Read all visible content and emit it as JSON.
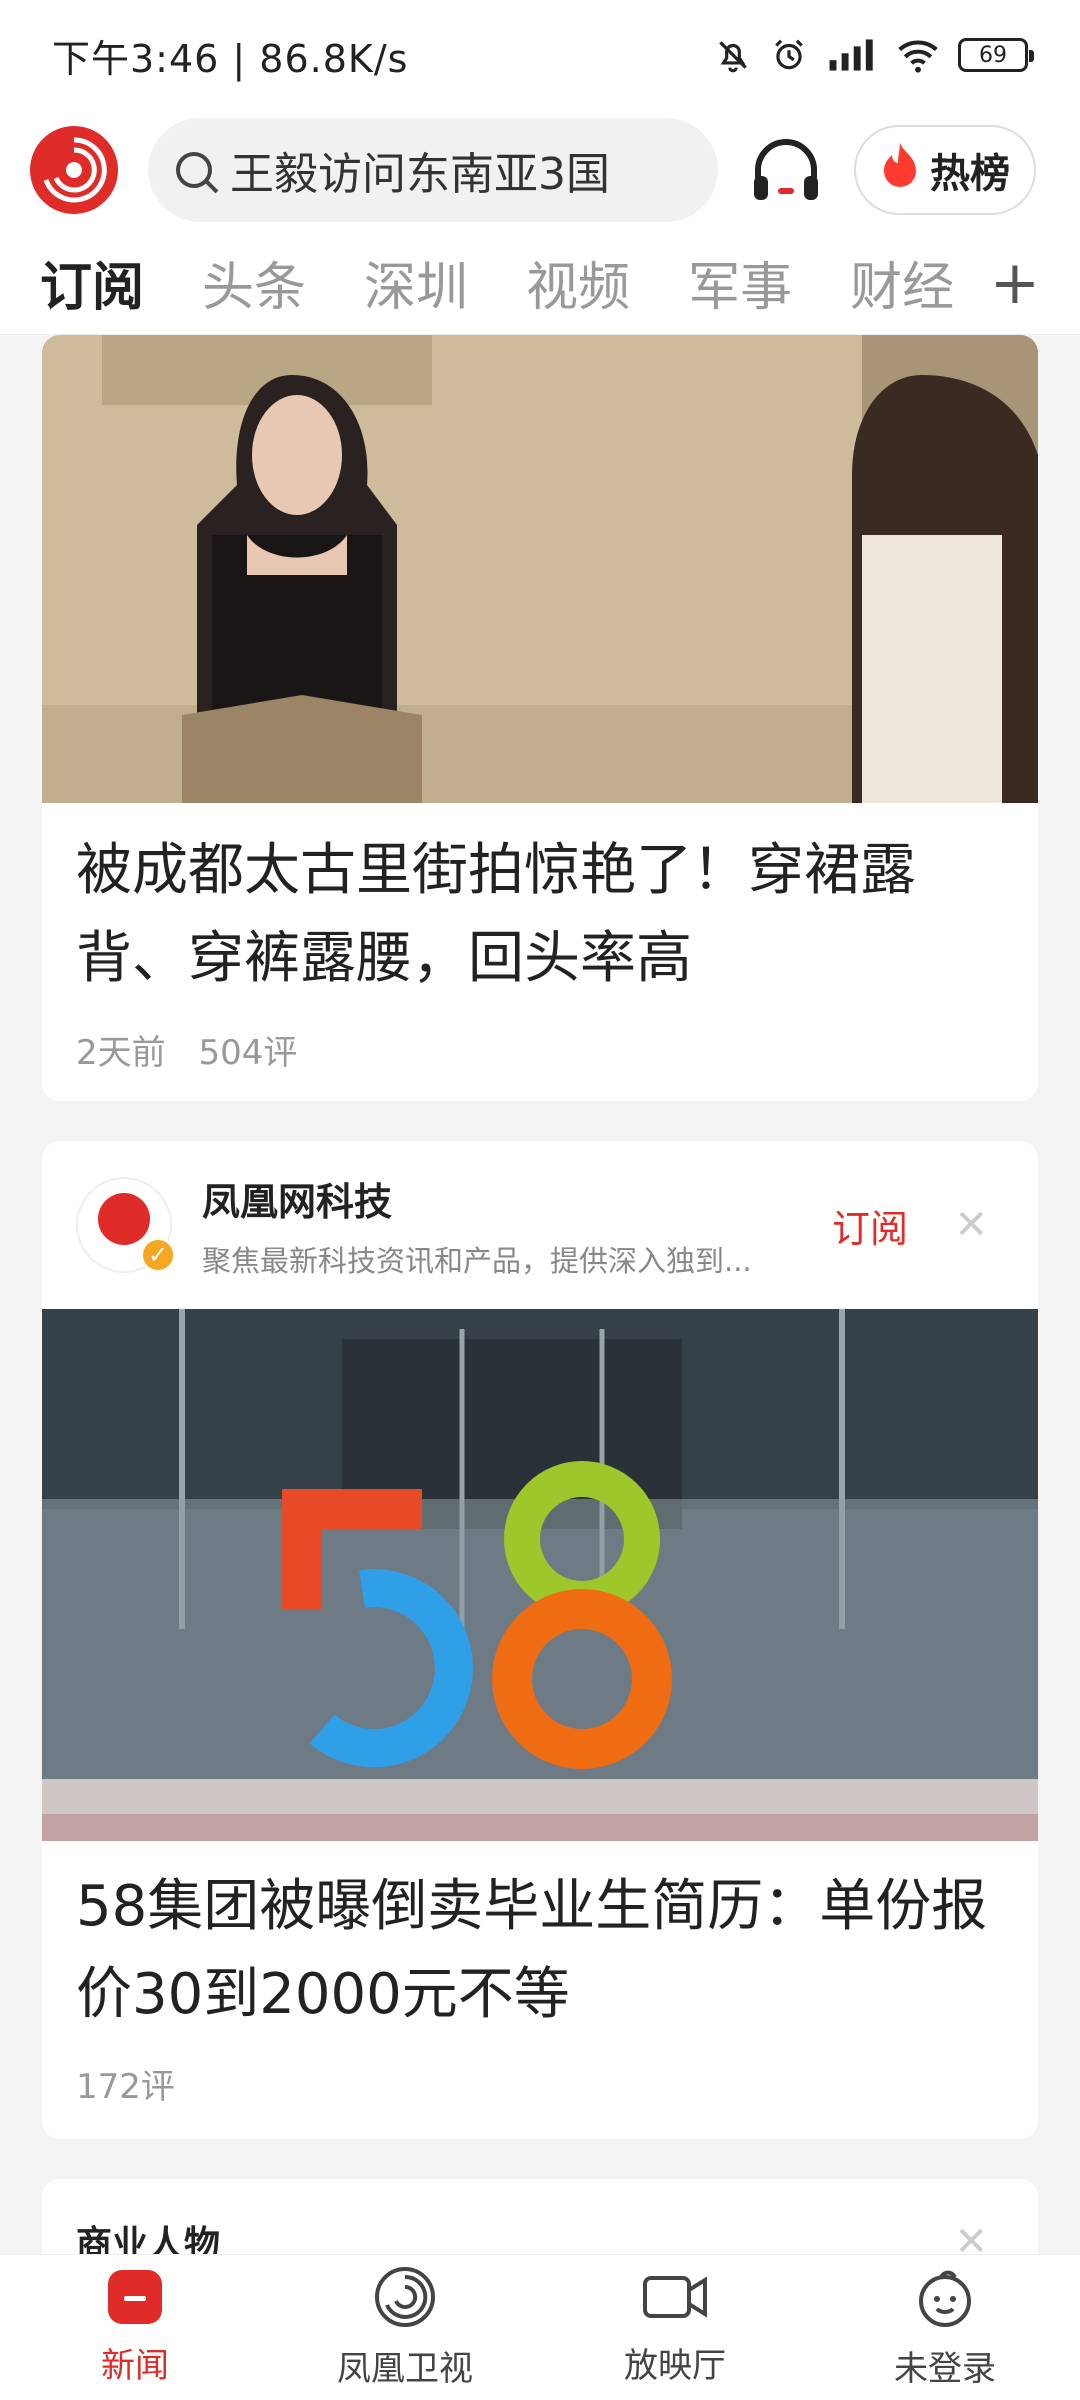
{
  "status": {
    "time_speed": "下午3:46 | 86.8K/s",
    "battery": "69"
  },
  "header": {
    "search_placeholder": "王毅访问东南亚3国",
    "hot_label": "热榜"
  },
  "tabs": [
    {
      "label": "订阅"
    },
    {
      "label": "头条"
    },
    {
      "label": "深圳"
    },
    {
      "label": "视频"
    },
    {
      "label": "军事"
    },
    {
      "label": "财经"
    }
  ],
  "tabs_plus": "+",
  "feed": {
    "item1": {
      "headline": "被成都太古里街拍惊艳了！穿裙露背、穿裤露腰，回头率高",
      "time": "2天前",
      "comments": "504评"
    },
    "item2": {
      "source_name": "凤凰网科技",
      "source_desc": "聚焦最新科技资讯和产品，提供深入独到...",
      "subscribe": "订阅",
      "headline": "58集团被曝倒卖毕业生简历：单份报价30到2000元不等",
      "comments": "172评",
      "image_text": "58"
    },
    "item3": {
      "title": "商业人物"
    }
  },
  "nav": [
    {
      "label": "新闻",
      "icon": "news-icon"
    },
    {
      "label": "凤凰卫视",
      "icon": "phoenix-tv-icon"
    },
    {
      "label": "放映厅",
      "icon": "video-camera-icon"
    },
    {
      "label": "未登录",
      "icon": "user-avatar-icon"
    }
  ],
  "colors": {
    "accent": "#e02c28"
  }
}
